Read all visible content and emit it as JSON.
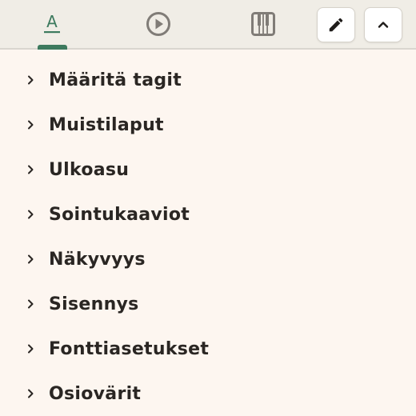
{
  "toolbar": {
    "tabs": [
      {
        "icon": "text-format-icon",
        "active": true
      },
      {
        "icon": "play-circle-icon",
        "active": false
      },
      {
        "icon": "piano-keys-icon",
        "active": false
      }
    ],
    "active_color": "#3d7a5e",
    "buttons": [
      {
        "icon": "pencil-icon"
      },
      {
        "icon": "chevron-up-icon"
      }
    ]
  },
  "menu": {
    "items": [
      {
        "label": "Määritä tagit"
      },
      {
        "label": "Muistilaput"
      },
      {
        "label": "Ulkoasu"
      },
      {
        "label": "Sointukaaviot"
      },
      {
        "label": "Näkyvyys"
      },
      {
        "label": "Sisennys"
      },
      {
        "label": "Fonttiasetukset"
      },
      {
        "label": "Osiovärit"
      }
    ]
  }
}
